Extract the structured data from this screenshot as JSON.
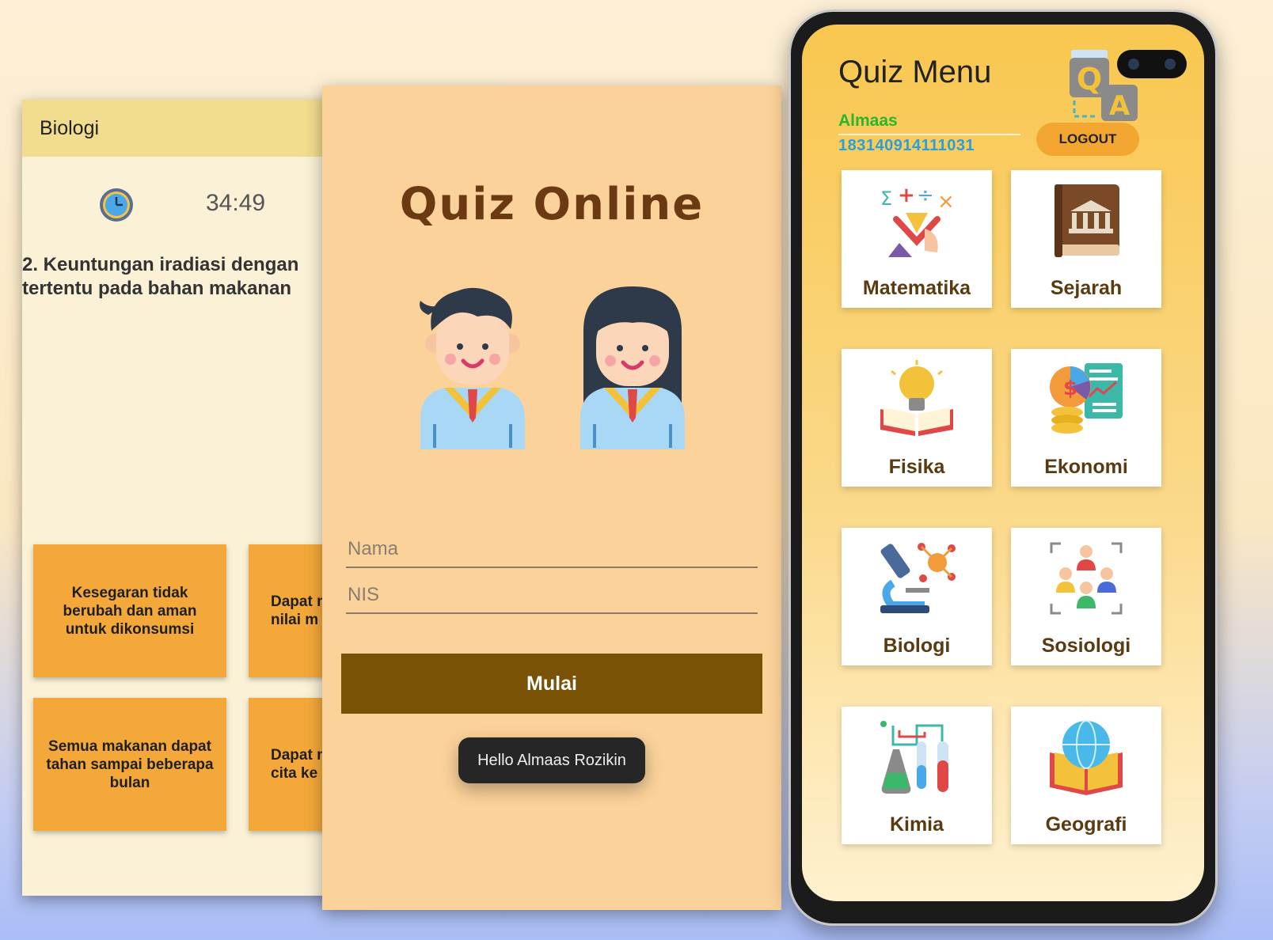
{
  "quiz": {
    "header_title": "Biologi",
    "timer": "34:49",
    "question_line1": "2. Keuntungan iradiasi dengan",
    "question_line2": "tertentu pada bahan makanan",
    "answers": [
      {
        "label": "Kesegaran tidak berubah dan aman untuk dikonsumsi"
      },
      {
        "label": "Dapat m nilai m"
      },
      {
        "label": "Semua makanan dapat tahan sampai beberapa bulan"
      },
      {
        "label": "Dapat m cita ke"
      }
    ]
  },
  "login": {
    "title": "Quiz Online",
    "name_placeholder": "Nama",
    "nis_placeholder": "NIS",
    "start_button": "Mulai",
    "toast": "Hello Almaas Rozikin"
  },
  "menu": {
    "title": "Quiz Menu",
    "user_name": "Almaas",
    "user_nis": "183140914111031",
    "logout_label": "LOGOUT",
    "subjects": [
      {
        "label": "Matematika",
        "icon": "math-icon"
      },
      {
        "label": "Sejarah",
        "icon": "history-book-icon"
      },
      {
        "label": "Fisika",
        "icon": "lightbulb-book-icon"
      },
      {
        "label": "Ekonomi",
        "icon": "economy-chart-icon"
      },
      {
        "label": "Biologi",
        "icon": "microscope-icon"
      },
      {
        "label": "Sosiologi",
        "icon": "people-group-icon"
      },
      {
        "label": "Kimia",
        "icon": "chemistry-flask-icon"
      },
      {
        "label": "Geografi",
        "icon": "globe-book-icon"
      }
    ]
  },
  "colors": {
    "quiz_header": "#f1dc8f",
    "answer_card": "#f5a83a",
    "login_bg": "#fbd29a",
    "start_button": "#7a5205",
    "menu_gradient_top": "#f9c74f",
    "user_name": "#2bb52b",
    "user_nis": "#2a9fd8",
    "logout_button": "#f3a630"
  }
}
